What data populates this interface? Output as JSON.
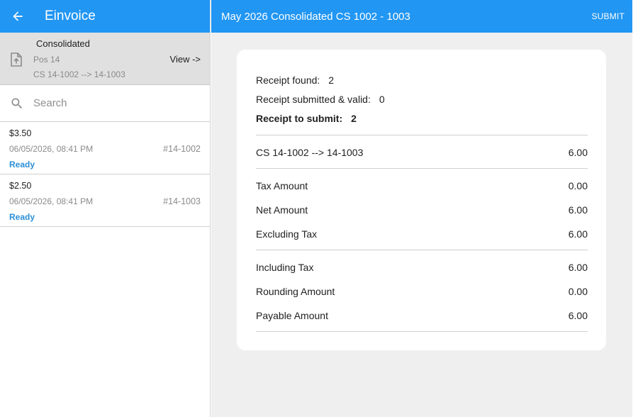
{
  "app": {
    "title": "Einvoice",
    "back_icon": "arrow-left-icon"
  },
  "consolidated": {
    "icon": "upload-file-icon",
    "title": "Consolidated",
    "pos": "Pos 14",
    "range": "CS 14-1002 --> 14-1003",
    "view_label": "View ->"
  },
  "search": {
    "icon": "search-icon",
    "placeholder": "Search",
    "value": ""
  },
  "invoices": [
    {
      "amount": "$3.50",
      "datetime": "06/05/2026, 08:41 PM",
      "number": "#14-1002",
      "status": "Ready"
    },
    {
      "amount": "$2.50",
      "datetime": "06/05/2026, 08:41 PM",
      "number": "#14-1003",
      "status": "Ready"
    }
  ],
  "detail": {
    "title": "May 2026 Consolidated CS 1002 - 1003",
    "submit_label": "SUBMIT",
    "summary": {
      "found_label": "Receipt found:",
      "found_value": "2",
      "valid_label": "Receipt submitted & valid:",
      "valid_value": "0",
      "to_submit_label": "Receipt to submit:",
      "to_submit_value": "2"
    },
    "range_line": {
      "label": "CS 14-1002 --> 14-1003",
      "value": "6.00"
    },
    "amounts_a": [
      {
        "label": "Tax Amount",
        "value": "0.00"
      },
      {
        "label": "Net Amount",
        "value": "6.00"
      },
      {
        "label": "Excluding Tax",
        "value": "6.00"
      }
    ],
    "amounts_b": [
      {
        "label": "Including Tax",
        "value": "6.00"
      },
      {
        "label": "Rounding Amount",
        "value": "0.00"
      },
      {
        "label": "Payable Amount",
        "value": "6.00"
      }
    ]
  },
  "colors": {
    "app_bar": "#2196f3",
    "status_ready": "#2b8fd6",
    "selected_row": "#e0e0e0",
    "detail_background": "#efefef"
  }
}
